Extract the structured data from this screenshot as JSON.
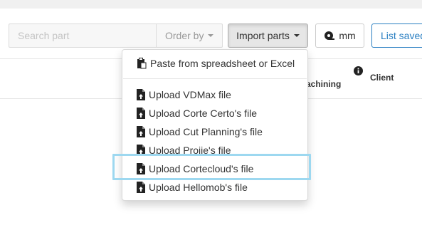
{
  "toolbar": {
    "search_placeholder": "Search part",
    "order_by_label": "Order by",
    "import_label": "Import parts",
    "unit_label": "mm",
    "list_saved_label": "List saved"
  },
  "table": {
    "machining_header": "Machining",
    "client_header": "Client"
  },
  "import_menu": {
    "items": [
      {
        "label": "Paste from spreadsheet or Excel",
        "icon": "clipboard-icon"
      },
      {
        "label": "Upload VDMax file",
        "icon": "file-upload-icon"
      },
      {
        "label": "Upload Corte Certo's file",
        "icon": "file-upload-icon"
      },
      {
        "label": "Upload Cut Planning's file",
        "icon": "file-upload-icon"
      },
      {
        "label": "Upload Projje's file",
        "icon": "file-upload-icon"
      },
      {
        "label": "Upload Cortecloud's file",
        "icon": "file-upload-icon"
      },
      {
        "label": "Upload Hellomob's file",
        "icon": "file-upload-icon"
      }
    ]
  },
  "colors": {
    "accent": "#2a7fc2",
    "focus_ring": "#9dd8f0"
  }
}
